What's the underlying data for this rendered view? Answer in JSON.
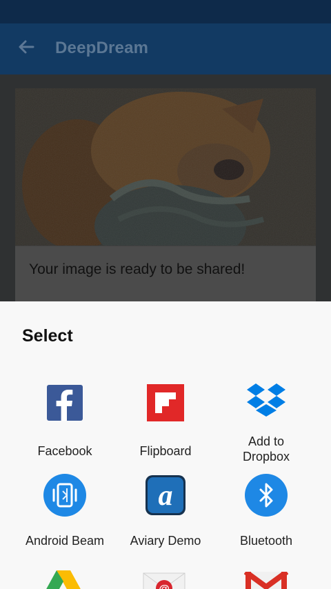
{
  "app": {
    "title": "DeepDream",
    "back_icon": "arrow-left-icon"
  },
  "card": {
    "message": "Your image is ready to be shared!"
  },
  "share_sheet": {
    "title": "Select",
    "apps": [
      {
        "label": "Facebook",
        "icon": "facebook-icon"
      },
      {
        "label": "Flipboard",
        "icon": "flipboard-icon"
      },
      {
        "label_line1": "Add to",
        "label_line2": "Dropbox",
        "icon": "dropbox-icon"
      },
      {
        "label": "Android Beam",
        "icon": "android-beam-icon"
      },
      {
        "label": "Aviary Demo",
        "icon": "aviary-icon"
      },
      {
        "label": "Bluetooth",
        "icon": "bluetooth-icon"
      }
    ]
  },
  "colors": {
    "facebook": "#3b5998",
    "flipboard": "#e12828",
    "dropbox": "#007ee5",
    "blue_circle": "#1e88e5"
  }
}
